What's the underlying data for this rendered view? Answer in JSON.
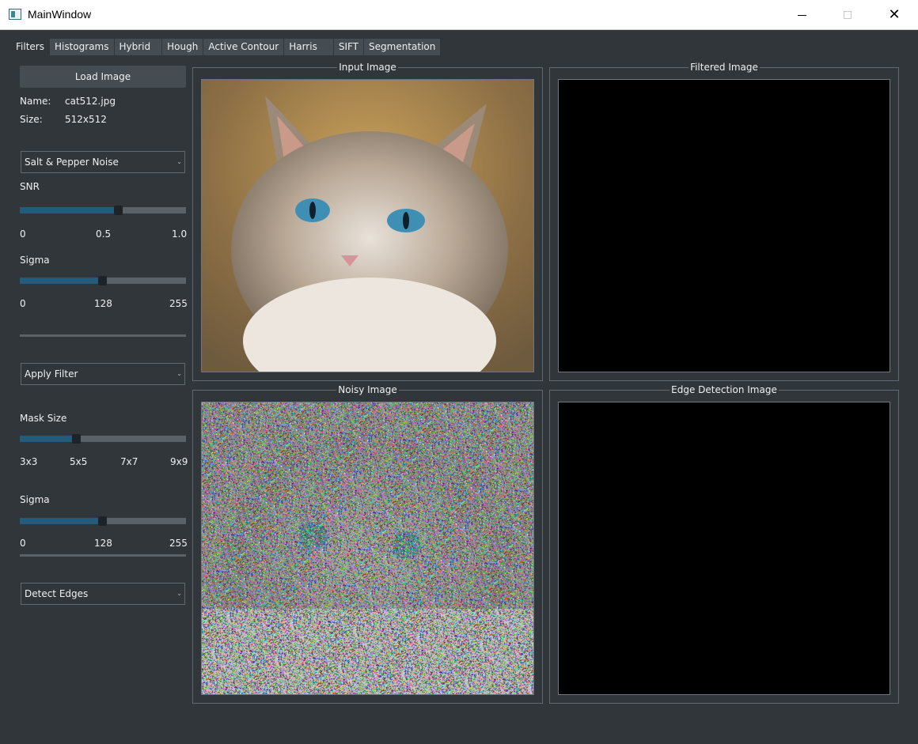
{
  "window": {
    "title": "MainWindow"
  },
  "tabs": [
    "Filters",
    "Histograms",
    "Hybrid",
    "Hough",
    "Active Contour",
    "Harris",
    "SIFT",
    "Segmentation"
  ],
  "sidebar": {
    "load_button": "Load Image",
    "name_label": "Name:",
    "name_value": "cat512.jpg",
    "size_label": "Size:",
    "size_value": "512x512",
    "noise_combo": "Salt & Pepper Noise",
    "snr": {
      "label": "SNR",
      "ticks": [
        "0",
        "0.5",
        "1.0"
      ],
      "value": 0.59
    },
    "sigma1": {
      "label": "Sigma",
      "ticks": [
        "0",
        "128",
        "255"
      ],
      "value": 128
    },
    "filter_combo": "Apply Filter",
    "mask": {
      "label": "Mask Size",
      "ticks": [
        "3x3",
        "5x5",
        "7x7",
        "9x9"
      ],
      "value": "5x5"
    },
    "sigma2": {
      "label": "Sigma",
      "ticks": [
        "0",
        "128",
        "255"
      ],
      "value": 128
    },
    "edge_combo": "Detect Edges"
  },
  "panels": {
    "input": "Input Image",
    "filtered": "Filtered Image",
    "noisy": "Noisy Image",
    "edge": "Edge Detection Image"
  },
  "icons": [
    "app-icon",
    "minimize-icon",
    "maximize-icon",
    "close-icon",
    "chevron-down-icon"
  ],
  "colors": {
    "background": "#31363b",
    "slider_fill": "#245a7a",
    "tab_bg": "#454c52"
  }
}
